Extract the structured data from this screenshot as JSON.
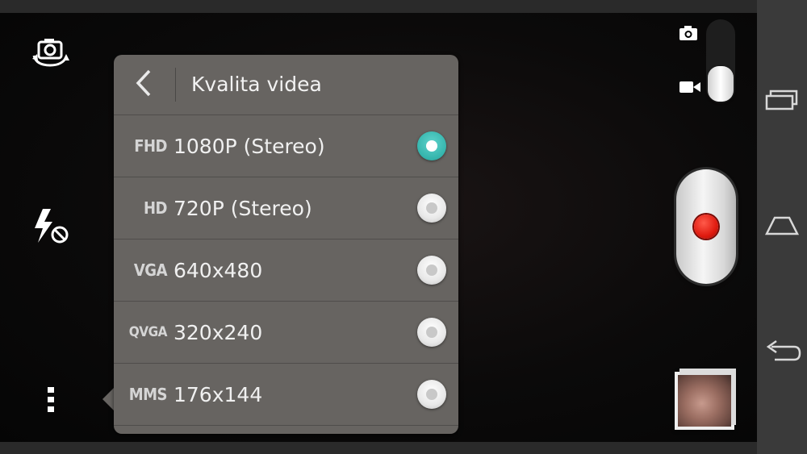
{
  "panel": {
    "title": "Kvalita videa",
    "options": [
      {
        "tag": "FHD",
        "label": "1080P (Stereo)",
        "selected": true
      },
      {
        "tag": "HD",
        "label": "720P (Stereo)",
        "selected": false
      },
      {
        "tag": "VGA",
        "label": "640x480",
        "selected": false
      },
      {
        "tag": "QVGA",
        "label": "320x240",
        "selected": false
      },
      {
        "tag": "MMS",
        "label": "176x144",
        "selected": false
      }
    ]
  },
  "icons": {
    "switch_camera": "switch-camera-icon",
    "flash_off": "flash-off-icon",
    "more": "more-vertical-icon",
    "back": "chevron-left-icon",
    "photo_mode": "camera-icon",
    "video_mode": "video-camera-icon",
    "record": "record-icon",
    "recent_apps": "recent-apps-icon",
    "home": "home-icon",
    "nav_back": "back-arrow-icon"
  },
  "colors": {
    "selected_radio": "#34b4ac",
    "record_dot": "#e01b10",
    "panel_bg": "#676461"
  }
}
